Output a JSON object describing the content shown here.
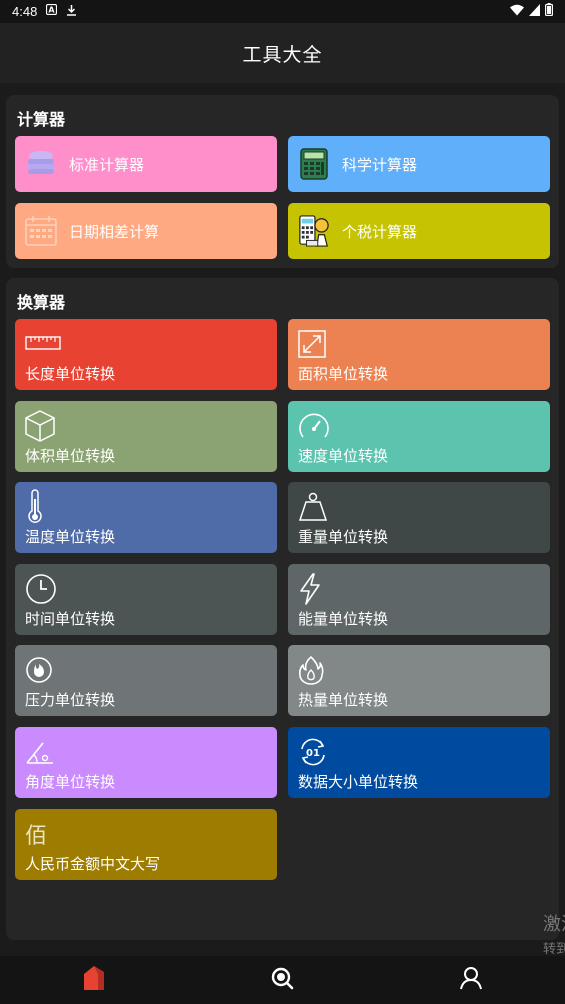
{
  "status_bar": {
    "time": "4:48"
  },
  "app_bar": {
    "title": "工具大全"
  },
  "calculators": {
    "title": "计算器",
    "items": [
      {
        "label": "标准计算器",
        "color": "#ff8fcb",
        "icon": "coins-icon"
      },
      {
        "label": "科学计算器",
        "color": "#60affa",
        "icon": "calculator-icon"
      },
      {
        "label": "日期相差计算",
        "color": "#ffa982",
        "icon": "calendar-icon"
      },
      {
        "label": "个税计算器",
        "color": "#c6c302",
        "icon": "tax-icon"
      }
    ]
  },
  "converters": {
    "title": "换算器",
    "items": [
      {
        "label": "长度单位转换",
        "color": "#e84232",
        "icon": "ruler-icon"
      },
      {
        "label": "面积单位转换",
        "color": "#ec8252",
        "icon": "area-icon"
      },
      {
        "label": "体积单位转换",
        "color": "#8ba373",
        "icon": "cube-icon"
      },
      {
        "label": "速度单位转换",
        "color": "#5cc3ae",
        "icon": "speedometer-icon"
      },
      {
        "label": "温度单位转换",
        "color": "#4f6ba8",
        "icon": "thermometer-icon"
      },
      {
        "label": "重量单位转换",
        "color": "#3f4847",
        "icon": "weight-icon"
      },
      {
        "label": "时间单位转换",
        "color": "#4d5554",
        "icon": "clock-icon"
      },
      {
        "label": "能量单位转换",
        "color": "#5f6667",
        "icon": "lightning-icon"
      },
      {
        "label": "压力单位转换",
        "color": "#6f7576",
        "icon": "pressure-icon"
      },
      {
        "label": "热量单位转换",
        "color": "#828787",
        "icon": "flame-icon"
      },
      {
        "label": "角度单位转换",
        "color": "#c98bfd",
        "icon": "angle-icon"
      },
      {
        "label": "数据大小单位转换",
        "color": "#004aa0",
        "icon": "data-icon"
      },
      {
        "label": "人民币金额中文大写",
        "color": "#9e7c00",
        "icon": "bai-icon",
        "glyph": "佰"
      }
    ]
  },
  "watermark": {
    "line1": "激活 Windows",
    "line2": "转到设置以激活 Windows。"
  },
  "bottom_nav": [
    {
      "name": "home",
      "icon": "home-icon",
      "color": "#e84232"
    },
    {
      "name": "search",
      "icon": "search-icon",
      "color": "#ffffff"
    },
    {
      "name": "profile",
      "icon": "user-icon",
      "color": "#ffffff"
    }
  ]
}
